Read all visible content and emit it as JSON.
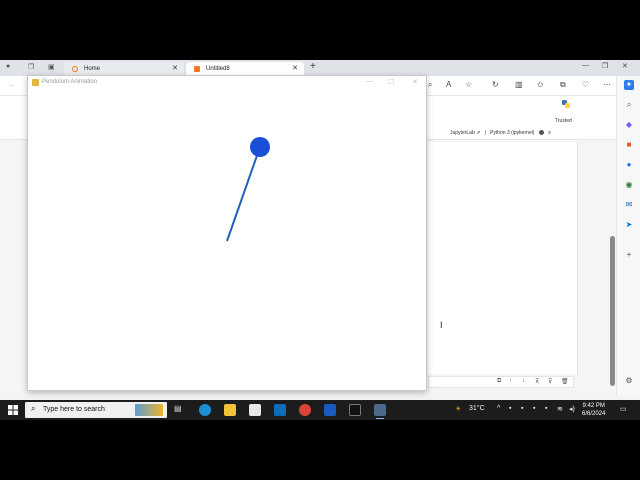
{
  "browser": {
    "tabs": [
      {
        "label": "Home",
        "favicon_color": "#f37626"
      },
      {
        "label": "Untitled8",
        "favicon_color": "#f37626"
      }
    ],
    "new_tab_icon": "plus-icon"
  },
  "jupyter": {
    "trusted_label": "Trusted",
    "jupyterlab_label": "JupyterLab",
    "kernel_label": "Python 3 (ipykernel)"
  },
  "pendulum_window": {
    "title": "Pendulum Animation",
    "rod_color": "#1f5fbf",
    "bob_color": "#1a4fd6"
  },
  "taskbar": {
    "search_placeholder": "Type here to search",
    "weather": "31°C",
    "time": "9:42 PM",
    "date": "6/6/2024"
  }
}
